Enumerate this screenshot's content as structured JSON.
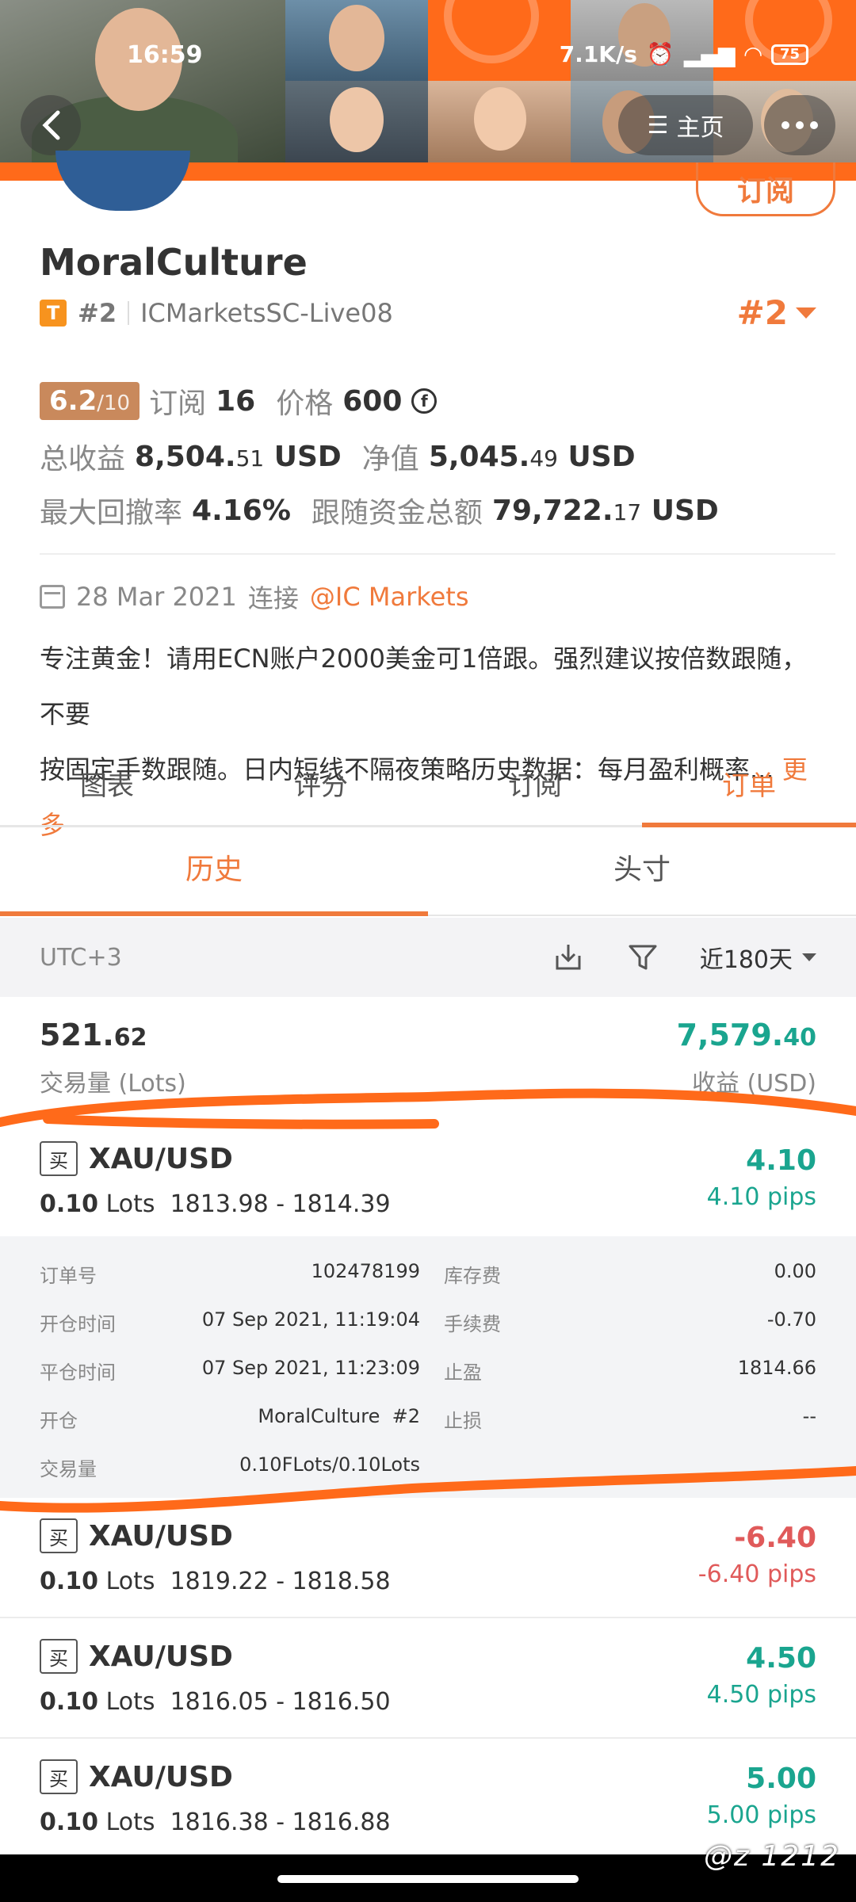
{
  "status_bar": {
    "time": "16:59",
    "speed": "7.1K/s",
    "battery": "75"
  },
  "nav": {
    "home_label": "主页"
  },
  "header": {
    "subscribe_label": "订阅"
  },
  "profile": {
    "name": "MoralCulture",
    "badge": "T",
    "rank_small": "#2",
    "server": "ICMarketsSC-Live08",
    "rank_big": "#2",
    "score": "6.2",
    "score_max": "/10",
    "subs_label": "订阅",
    "subs_value": "16",
    "price_label": "价格",
    "price_value": "600",
    "total_profit_label": "总收益",
    "total_profit_int": "8,504.",
    "total_profit_dec": "51",
    "total_profit_unit": "USD",
    "equity_label": "净值",
    "equity_int": "5,045.",
    "equity_dec": "49",
    "equity_unit": "USD",
    "drawdown_label": "最大回撤率",
    "drawdown_value": "4.16%",
    "follow_label": "跟随资金总额",
    "follow_int": "79,722.",
    "follow_dec": "17",
    "follow_unit": "USD",
    "date": "28 Mar 2021",
    "connect_label": "连接",
    "broker": "@IC Markets",
    "desc_line1": "专注黄金！请用ECN账户2000美金可1倍跟。强烈建议按倍数跟随，不要",
    "desc_line2": "按固定手数跟随。日内短线不隔夜策略历史数据：每月盈利概率...",
    "more_label": "更多"
  },
  "tabs": [
    "图表",
    "评分",
    "订阅",
    "订单"
  ],
  "subtabs": [
    "历史",
    "头寸"
  ],
  "filter": {
    "timezone": "UTC+3",
    "range": "近180天"
  },
  "summary": {
    "lots_int": "521.",
    "lots_dec": "62",
    "lots_label": "交易量 (Lots)",
    "profit_int": "7,579.",
    "profit_dec": "40",
    "profit_label": "收益 (USD)"
  },
  "orders": [
    {
      "type": "买",
      "symbol": "XAU/USD",
      "lots": "0.10",
      "lots_unit": "Lots",
      "prices": "1813.98 - 1814.39",
      "profit": "4.10",
      "pips": "4.10 pips"
    },
    {
      "type": "买",
      "symbol": "XAU/USD",
      "lots": "0.10",
      "lots_unit": "Lots",
      "prices": "1819.22 - 1818.58",
      "profit": "-6.40",
      "pips": "-6.40 pips"
    },
    {
      "type": "买",
      "symbol": "XAU/USD",
      "lots": "0.10",
      "lots_unit": "Lots",
      "prices": "1816.05 - 1816.50",
      "profit": "4.50",
      "pips": "4.50 pips"
    },
    {
      "type": "买",
      "symbol": "XAU/USD",
      "lots": "0.10",
      "lots_unit": "Lots",
      "prices": "1816.38 - 1816.88",
      "profit": "5.00",
      "pips": "5.00 pips"
    }
  ],
  "detail": {
    "order_no_label": "订单号",
    "order_no": "102478199",
    "swap_label": "库存费",
    "swap": "0.00",
    "open_time_label": "开仓时间",
    "open_time": "07 Sep 2021, 11:19:04",
    "fee_label": "手续费",
    "fee": "-0.70",
    "close_time_label": "平仓时间",
    "close_time": "07 Sep 2021, 11:23:09",
    "tp_label": "止盈",
    "tp": "1814.66",
    "open_label": "开仓",
    "open_by": "MoralCulture  #2",
    "sl_label": "止损",
    "sl": "--",
    "volume_label": "交易量",
    "volume": "0.10FLots/0.10Lots"
  },
  "watermark": "@z 1212",
  "colors": {
    "accent": "#f07a3c",
    "profit": "#1aa58f",
    "loss": "#e05a5a"
  }
}
